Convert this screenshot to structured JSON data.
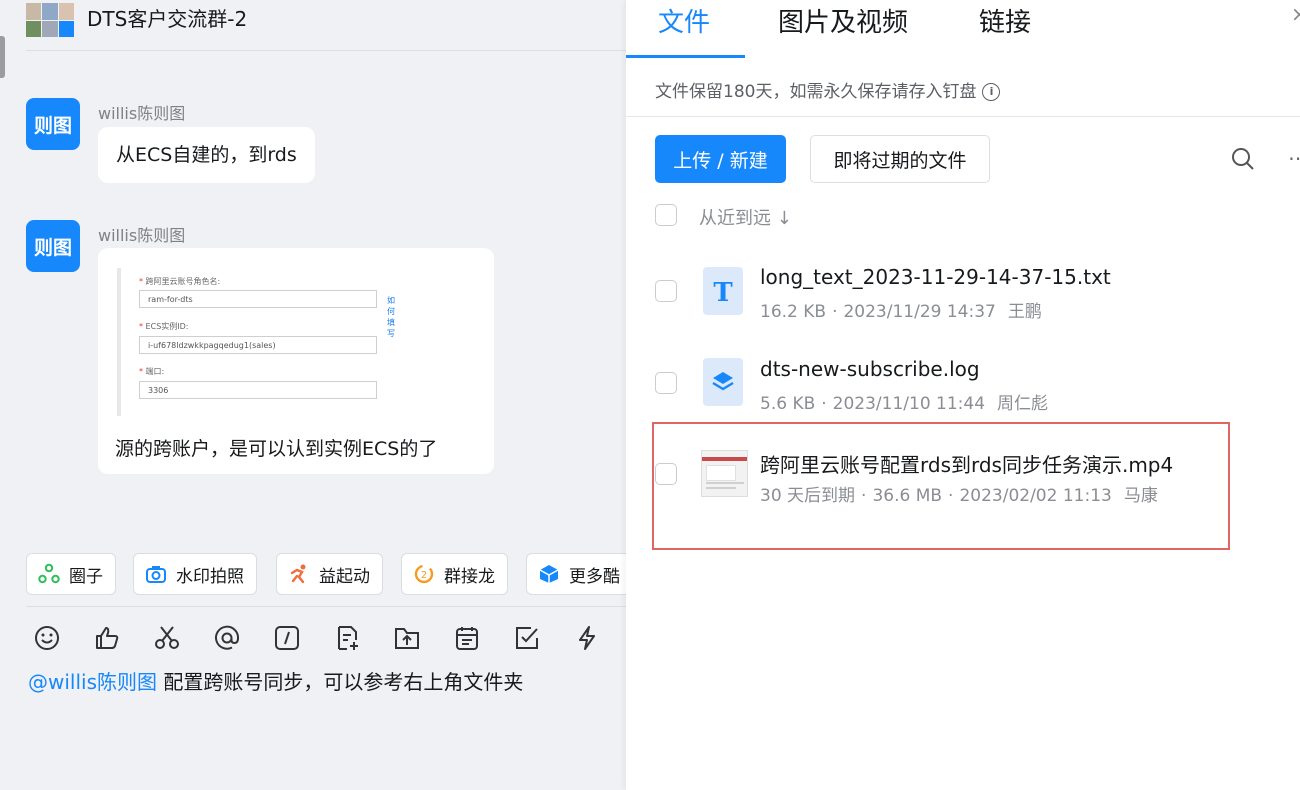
{
  "chat": {
    "title": "DTS客户交流群-2",
    "messages": [
      {
        "avatar_text": "则图",
        "sender": "willis陈则图",
        "text": "从ECS自建的，到rds"
      },
      {
        "avatar_text": "则图",
        "sender": "willis陈则图",
        "screenshot": {
          "label1": "跨阿里云账号角色名:",
          "field1": "ram-for-dts",
          "link": "如何填写",
          "label2": "ECS实例ID:",
          "field2": "i-uf678ldzwkkpagqedug1(sales)",
          "label3": "端口:",
          "field3": "3306"
        },
        "text": "源的跨账户，是可以认到实例ECS的了"
      }
    ],
    "quick_actions": [
      {
        "label": "圈子",
        "icon": "circle-group-icon"
      },
      {
        "label": "水印拍照",
        "icon": "camera-icon"
      },
      {
        "label": "益起动",
        "icon": "running-icon"
      },
      {
        "label": "群接龙",
        "icon": "solitaire-icon"
      },
      {
        "label": "更多酷",
        "icon": "cube-icon"
      }
    ],
    "toolbar_icons": [
      "emoji-icon",
      "thumbs-up-icon",
      "scissors-icon",
      "at-icon",
      "slash-command-icon",
      "doc-add-icon",
      "upload-icon",
      "calendar-icon",
      "task-check-icon",
      "lightning-icon"
    ],
    "draft": {
      "mention": "@willis陈则图",
      "text": " 配置跨账号同步，可以参考右上角文件夹"
    }
  },
  "panel": {
    "tabs": [
      "文件",
      "图片及视频",
      "链接"
    ],
    "active_tab": "文件",
    "notice": "文件保留180天，如需永久保存请存入钉盘",
    "upload_button": "上传 / 新建",
    "expiring_button": "即将过期的文件",
    "sort_label": "从近到远 ↓",
    "files": [
      {
        "name": "long_text_2023-11-29-14-37-15.txt",
        "meta": [
          "16.2 KB",
          "2023/11/29 14:37",
          "王鹏"
        ],
        "icon": "text-file-icon"
      },
      {
        "name": "dts-new-subscribe.log",
        "meta": [
          "5.6 KB",
          "2023/11/10 11:44",
          "周仁彪"
        ],
        "icon": "layers-file-icon"
      },
      {
        "name": "跨阿里云账号配置rds到rds同步任务演示.mp4",
        "meta": [
          "30 天后到期",
          "36.6 MB",
          "2023/02/02 11:13",
          "马康"
        ],
        "icon": "video-thumbnail"
      }
    ]
  },
  "colors": {
    "accent": "#1787fc",
    "highlight_border": "#e06565"
  }
}
